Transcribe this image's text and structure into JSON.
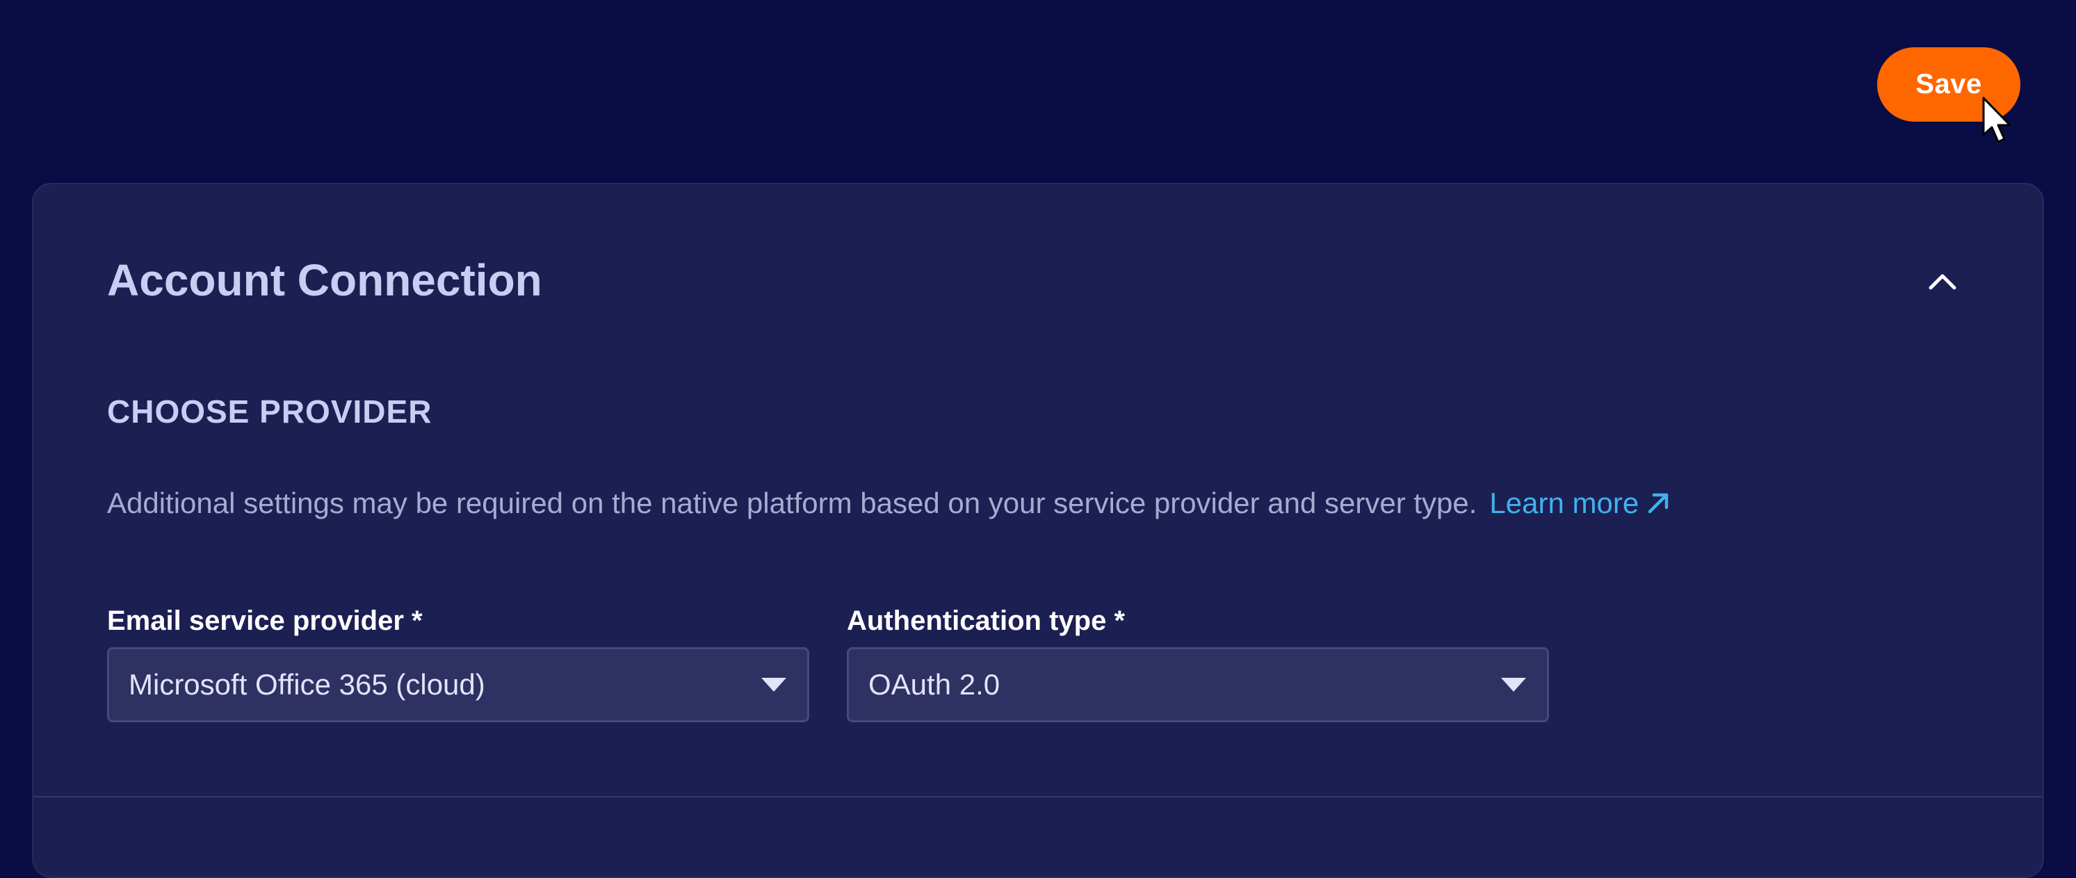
{
  "toolbar": {
    "save_label": "Save"
  },
  "card": {
    "title": "Account Connection",
    "collapse_icon": "chevron-up-icon"
  },
  "section": {
    "heading": "CHOOSE PROVIDER",
    "description": "Additional settings may be required on the native platform based on your service provider and server type.",
    "learn_more_label": "Learn more",
    "learn_more_icon": "external-link-arrow-icon"
  },
  "fields": {
    "email_provider": {
      "label": "Email service provider *",
      "value": "Microsoft Office 365 (cloud)"
    },
    "auth_type": {
      "label": "Authentication type *",
      "value": "OAuth 2.0"
    }
  },
  "colors": {
    "page_background": "#0a0d45",
    "card_background": "#1c1f52",
    "accent": "#fe6700",
    "link": "#3fb2ef",
    "heading_text": "#c9cdf3"
  }
}
